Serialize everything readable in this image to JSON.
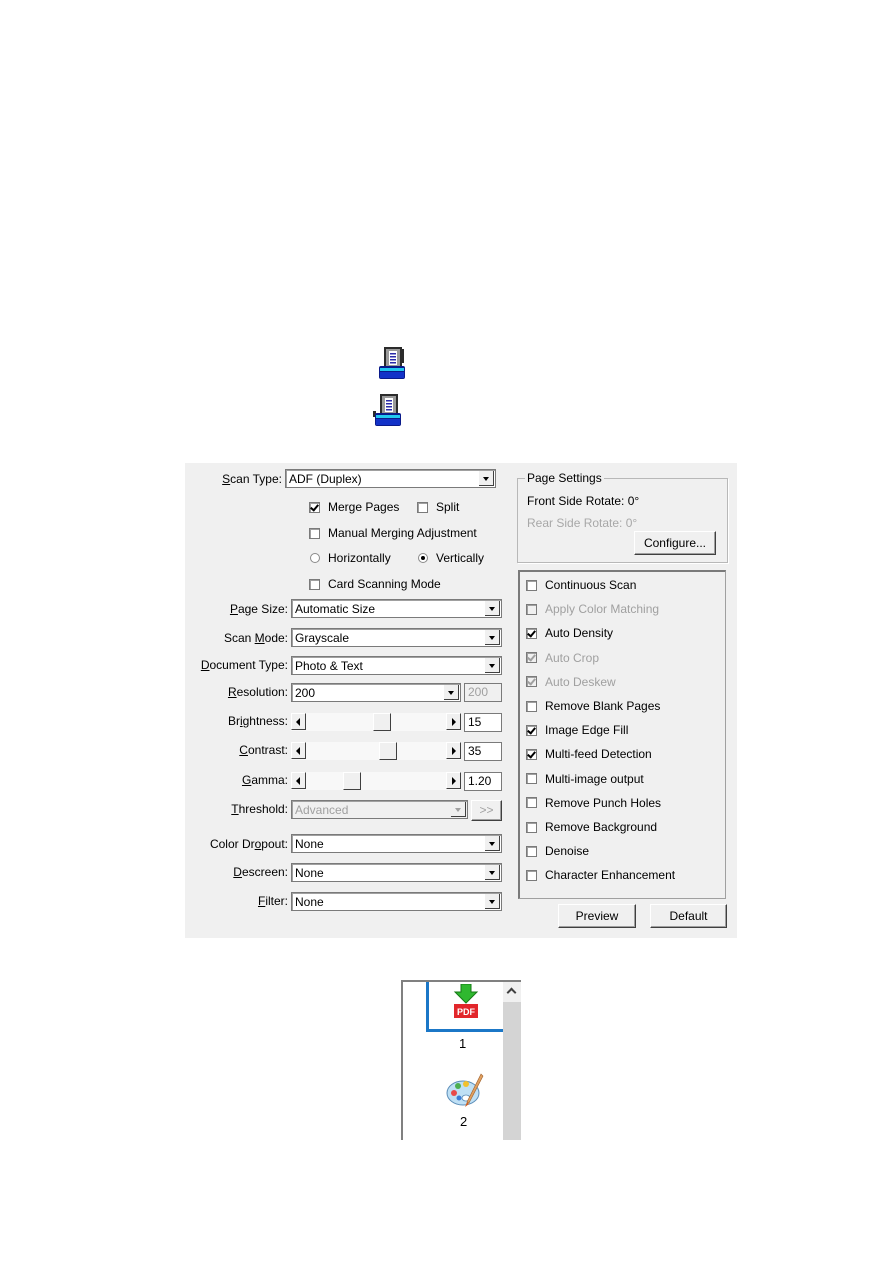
{
  "icons": {
    "scanner_icon_1": "scanner-icon",
    "scanner_icon_2": "scanner-icon"
  },
  "dialog": {
    "scan_type": {
      "label_pre": "",
      "label_u": "S",
      "label_post": "can Type:",
      "value": "ADF (Duplex)"
    },
    "merge_pages": {
      "label": "Merge Pages",
      "checked": true
    },
    "split": {
      "label": "Split",
      "checked": false
    },
    "manual_merging": {
      "label": "Manual Merging Adjustment",
      "checked": false
    },
    "horizontally": {
      "label": "Horizontally",
      "selected": false
    },
    "vertically": {
      "label": "Vertically",
      "selected": true
    },
    "card_scanning": {
      "label": "Card Scanning Mode",
      "checked": false
    },
    "page_size": {
      "label_pre": "",
      "label_u": "P",
      "label_post": "age Size:",
      "value": "Automatic Size"
    },
    "scan_mode": {
      "label_pre": "Scan ",
      "label_u": "M",
      "label_post": "ode:",
      "value": "Grayscale"
    },
    "document_type": {
      "label_pre": "",
      "label_u": "D",
      "label_post": "ocument Type:",
      "value": "Photo & Text"
    },
    "resolution": {
      "label_pre": "",
      "label_u": "R",
      "label_post": "esolution:",
      "value": "200",
      "custom_value": "200"
    },
    "brightness": {
      "label_pre": "Br",
      "label_u": "i",
      "label_post": "ghtness:",
      "value": "15",
      "position_fraction": 0.55
    },
    "contrast": {
      "label_pre": "",
      "label_u": "C",
      "label_post": "ontrast:",
      "value": "35",
      "position_fraction": 0.6
    },
    "gamma": {
      "label_pre": "",
      "label_u": "G",
      "label_post": "amma:",
      "value": "1.20",
      "position_fraction": 0.3
    },
    "threshold": {
      "label_pre": "",
      "label_u": "T",
      "label_post": "hreshold:",
      "value": "Advanced",
      "more_button": ">>"
    },
    "color_dropout": {
      "label_pre": "Color Dr",
      "label_u": "o",
      "label_post": "pout:",
      "value": "None"
    },
    "descreen": {
      "label_pre": "",
      "label_u": "D",
      "label_post": "escreen:",
      "value": "None"
    },
    "filter": {
      "label_pre": "",
      "label_u": "F",
      "label_post": "ilter:",
      "value": "None"
    },
    "page_settings": {
      "title": "Page Settings",
      "front_rotate": "Front Side Rotate: 0°",
      "rear_rotate": "Rear Side Rotate: 0°",
      "configure_button": "Configure..."
    },
    "options": [
      {
        "label": "Continuous Scan",
        "checked": false,
        "disabled": false
      },
      {
        "label": "Apply Color Matching",
        "checked": false,
        "disabled": true
      },
      {
        "label": "Auto Density",
        "checked": true,
        "disabled": false
      },
      {
        "label": "Auto Crop",
        "checked": true,
        "disabled": true
      },
      {
        "label": "Auto Deskew",
        "checked": true,
        "disabled": true
      },
      {
        "label": "Remove Blank Pages",
        "checked": false,
        "disabled": false
      },
      {
        "label": "Image Edge Fill",
        "checked": true,
        "disabled": false
      },
      {
        "label": "Multi-feed Detection",
        "checked": true,
        "disabled": false
      },
      {
        "label": "Multi-image output",
        "checked": false,
        "disabled": false
      },
      {
        "label": "Remove Punch Holes",
        "checked": false,
        "disabled": false
      },
      {
        "label": "Remove Background",
        "checked": false,
        "disabled": false
      },
      {
        "label": "Denoise",
        "checked": false,
        "disabled": false
      },
      {
        "label": "Character Enhancement",
        "checked": false,
        "disabled": false
      }
    ],
    "preview_button": "Preview",
    "default_button": "Default"
  },
  "thumbnails": {
    "items": [
      {
        "number": "1",
        "icon": "pdf-download-icon",
        "badge": "PDF",
        "selected": true
      },
      {
        "number": "2",
        "icon": "paint-palette-icon",
        "selected": false
      }
    ]
  }
}
